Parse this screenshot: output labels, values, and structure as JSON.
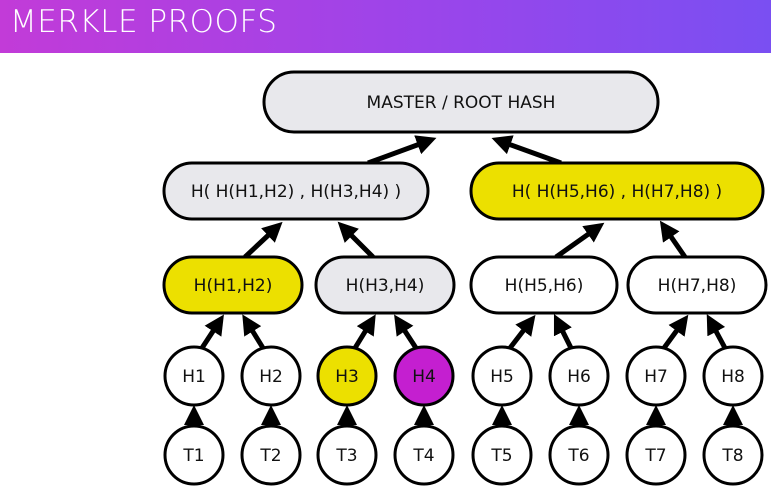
{
  "header": {
    "title": "MERKLE PROOFS"
  },
  "colors": {
    "default_fill": "#ffffff",
    "internal_fill": "#e8e8ec",
    "proof_fill": "#ece000",
    "target_fill": "#c41fd0",
    "edge": "#000000"
  },
  "tree": {
    "root": {
      "label": "MASTER / ROOT HASH",
      "role": "internal"
    },
    "level1": [
      {
        "label": "H( H(H1,H2) , H(H3,H4) )",
        "role": "internal"
      },
      {
        "label": "H( H(H5,H6) , H(H7,H8) )",
        "role": "proof"
      }
    ],
    "level2": [
      {
        "label": "H(H1,H2)",
        "role": "proof"
      },
      {
        "label": "H(H3,H4)",
        "role": "internal"
      },
      {
        "label": "H(H5,H6)",
        "role": "default"
      },
      {
        "label": "H(H7,H8)",
        "role": "default"
      }
    ],
    "hashes": [
      {
        "label": "H1",
        "role": "default"
      },
      {
        "label": "H2",
        "role": "default"
      },
      {
        "label": "H3",
        "role": "proof"
      },
      {
        "label": "H4",
        "role": "target"
      },
      {
        "label": "H5",
        "role": "default"
      },
      {
        "label": "H6",
        "role": "default"
      },
      {
        "label": "H7",
        "role": "default"
      },
      {
        "label": "H8",
        "role": "default"
      }
    ],
    "transactions": [
      {
        "label": "T1"
      },
      {
        "label": "T2"
      },
      {
        "label": "T3"
      },
      {
        "label": "T4"
      },
      {
        "label": "T5"
      },
      {
        "label": "T6"
      },
      {
        "label": "T7"
      },
      {
        "label": "T8"
      }
    ]
  }
}
